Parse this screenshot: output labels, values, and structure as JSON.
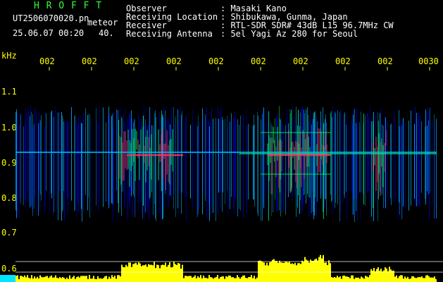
{
  "header": {
    "app_name": "H R O F F T",
    "file_name": "UT2506070020.pn",
    "mode": "meteor",
    "datetime": "25.06.07 00:20",
    "value": "40.",
    "info_labels": [
      "Observer",
      "Receiving Location",
      "Receiver",
      "Receiving Antenna"
    ],
    "info_values": [
      ": Masaki Kano",
      ": Shibukawa, Gunma, Japan",
      ": RTL-SDR SDR# 43dB L15 96.7MHz CW",
      ": 5el Yagi Az 280 for Seoul"
    ]
  },
  "plot": {
    "y_unit": "kHz",
    "y_ticks": [
      "1.1",
      "1.0",
      "0.9",
      "0.8",
      "0.7",
      "0.6"
    ],
    "x_ticks": [
      "002",
      "002",
      "002",
      "002",
      "002",
      "002",
      "002",
      "002",
      "002",
      "0030"
    ],
    "colors": {
      "background": "#000000",
      "noise_low": "#0000c8",
      "noise_mid": "#00b4ff",
      "signal_mid": "#00ff66",
      "signal_high": "#ff3366",
      "amplitude": "#ffff00",
      "grid": "#ffffff"
    }
  }
}
